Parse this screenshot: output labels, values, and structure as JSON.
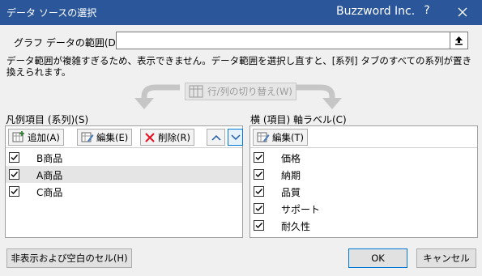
{
  "window": {
    "title": "データ ソースの選択",
    "brand": "Buzzword Inc.",
    "help": "?"
  },
  "range": {
    "label": "グラフ データの範囲(D):",
    "value": ""
  },
  "warning": "データ範囲が複雑すぎるため、表示できません。データ範囲を選択し直すと、[系列] タブのすべての系列が置き換えられます。",
  "switch_label": "行/列の切り替え(W)",
  "legend": {
    "label": "凡例項目 (系列)(S)",
    "toolbar": {
      "add": "追加(A)",
      "edit": "編集(E)",
      "delete": "削除(R)"
    },
    "items": [
      {
        "label": "B商品",
        "checked": true
      },
      {
        "label": "A商品",
        "checked": true
      },
      {
        "label": "C商品",
        "checked": true
      }
    ]
  },
  "axis": {
    "label": "横 (項目) 軸ラベル(C)",
    "edit": "編集(T)",
    "items": [
      {
        "label": "価格",
        "checked": true
      },
      {
        "label": "納期",
        "checked": true
      },
      {
        "label": "品質",
        "checked": true
      },
      {
        "label": "サポート",
        "checked": true
      },
      {
        "label": "耐久性",
        "checked": true
      }
    ]
  },
  "buttons": {
    "hidden_cells": "非表示および空白のセル(H)",
    "ok": "OK",
    "cancel": "キャンセル"
  },
  "colors": {
    "titlebar": "#2b579a",
    "dialog": "#f0f0f0",
    "accent": "#0078d7",
    "delete_icon": "#e81123"
  }
}
